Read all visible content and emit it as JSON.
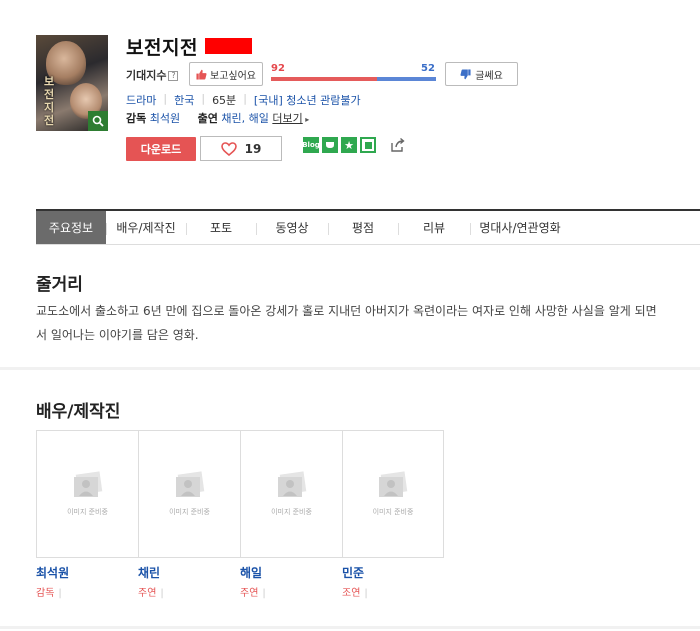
{
  "movie": {
    "title": "보전지전",
    "poster_text": "보전지전"
  },
  "expectation": {
    "label": "기대지수",
    "help_icon": "?",
    "want_button": "보고싶어요",
    "bad_button": "글쎄요",
    "want_score": "92",
    "bad_score": "52",
    "want_ratio": 0.64
  },
  "meta": {
    "genre": "드라마",
    "country": "한국",
    "runtime": "65분",
    "rating": "[국내] 청소년 관람불가"
  },
  "credits": {
    "director_label": "감독",
    "director": "최석원",
    "cast_label": "출연",
    "cast": "채린, 해일",
    "more": "더보기"
  },
  "actions": {
    "download": "다운로드",
    "likes": "19"
  },
  "sns": [
    "Blog",
    "",
    "★",
    ""
  ],
  "tabs": [
    "주요정보",
    "배우/제작진",
    "포토",
    "동영상",
    "평점",
    "리뷰",
    "명대사/연관영화"
  ],
  "synopsis": {
    "heading": "줄거리",
    "text": "교도소에서 출소하고 6년 만에 집으로 돌아온 강세가 홀로 지내던 아버지가 옥련이라는 여자로 인해 사망한 사실을 알게 되면서 일어나는 이야기를 담은 영화."
  },
  "cast_section": {
    "heading": "배우/제작진",
    "placeholder": "이미지 준비중",
    "people": [
      {
        "name": "최석원",
        "role": "감독"
      },
      {
        "name": "채린",
        "role": "주연"
      },
      {
        "name": "해일",
        "role": "주연"
      },
      {
        "name": "민준",
        "role": "조연"
      }
    ]
  },
  "colors": {
    "accent_red": "#e55454",
    "link_blue": "#1a52a8",
    "gauge_blue": "#5b86d6",
    "sns_green": "#2fa84f"
  }
}
